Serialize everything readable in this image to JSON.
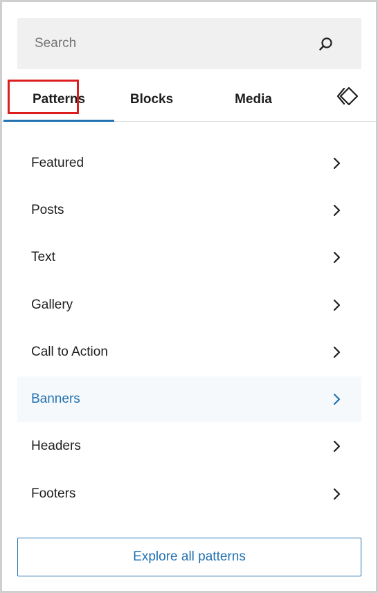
{
  "search": {
    "placeholder": "Search",
    "value": ""
  },
  "tabs": [
    {
      "label": "Patterns",
      "active": true
    },
    {
      "label": "Blocks",
      "active": false
    },
    {
      "label": "Media",
      "active": false
    }
  ],
  "synced_icon": "synced-patterns-icon",
  "categories": [
    {
      "label": "Featured",
      "active": false
    },
    {
      "label": "Posts",
      "active": false
    },
    {
      "label": "Text",
      "active": false
    },
    {
      "label": "Gallery",
      "active": false
    },
    {
      "label": "Call to Action",
      "active": false
    },
    {
      "label": "Banners",
      "active": true
    },
    {
      "label": "Headers",
      "active": false
    },
    {
      "label": "Footers",
      "active": false
    }
  ],
  "explore_button": {
    "label": "Explore all patterns"
  },
  "colors": {
    "accent": "#2271b1",
    "text": "#1e1e1e",
    "highlight": "#dd1e1e",
    "search_bg": "#f0f0f0",
    "active_row_bg": "#f5f9fb"
  }
}
